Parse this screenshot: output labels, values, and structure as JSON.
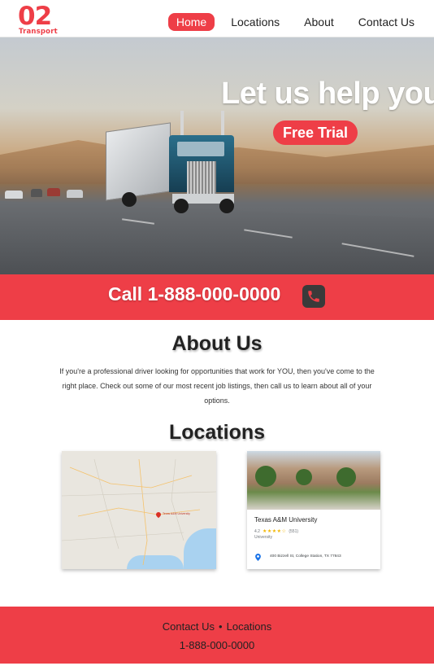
{
  "brand": {
    "logo_main": "02",
    "logo_sub": "Transport",
    "accent": "#ee3e47"
  },
  "nav": {
    "items": [
      {
        "label": "Home",
        "active": true
      },
      {
        "label": "Locations",
        "active": false
      },
      {
        "label": "About",
        "active": false
      },
      {
        "label": "Contact Us",
        "active": false
      }
    ]
  },
  "hero": {
    "title": "Let us help you",
    "cta_label": "Free Trial"
  },
  "call": {
    "text": "Call 1-888-000-0000",
    "icon": "phone-icon"
  },
  "about": {
    "title": "About Us",
    "body": "If you're a professional driver looking for opportunities that work for YOU, then you've come to the right place. Check out some of our most recent job listings, then call us to learn about all of your options."
  },
  "locations": {
    "title": "Locations",
    "map": {
      "pin_label": "Texas A&M University"
    },
    "place": {
      "name": "Texas A&M University",
      "rating": "4.2",
      "stars": "★★★★☆",
      "reviews": "(551)",
      "type": "University",
      "address": "400 Bizzell St, College Station, TX 77843"
    }
  },
  "footer": {
    "links": [
      "Contact Us",
      "Locations"
    ],
    "separator": "•",
    "phone": "1-888-000-0000"
  }
}
